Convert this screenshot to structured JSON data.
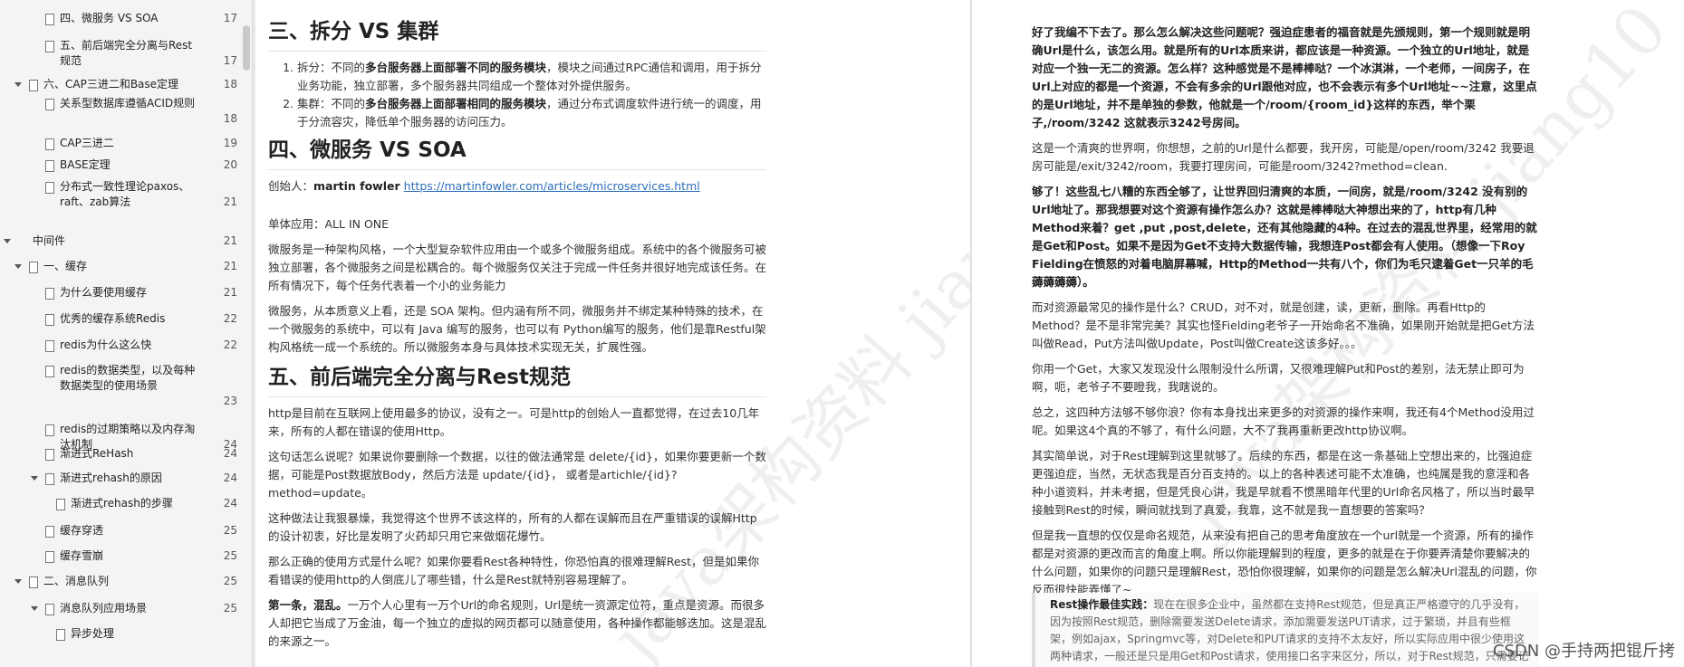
{
  "toc": [
    {
      "text": "四、微服务 VS SOA",
      "page": "17",
      "level": 2,
      "toggle": false
    },
    {
      "text": "五、前后端完全分离与Rest规范",
      "page": "17",
      "level": 2,
      "toggle": false
    },
    {
      "text": "六、CAP三进二和Base定理",
      "page": "18",
      "level": 1,
      "toggle": true
    },
    {
      "text": "关系型数据库遵循ACID规则",
      "page": "18",
      "level": 2,
      "toggle": false
    },
    {
      "text": "CAP三进二",
      "page": "19",
      "level": 2,
      "toggle": false
    },
    {
      "text": "BASE定理",
      "page": "20",
      "level": 2,
      "toggle": false
    },
    {
      "text": "分布式一致性理论paxos、raft、zab算法",
      "page": "21",
      "level": 2,
      "toggle": false
    },
    {
      "text": "中间件",
      "page": "21",
      "level": 0,
      "toggle": true
    },
    {
      "text": "一、缓存",
      "page": "21",
      "level": 1,
      "toggle": true
    },
    {
      "text": "为什么要使用缓存",
      "page": "21",
      "level": 2,
      "toggle": false
    },
    {
      "text": "优秀的缓存系统Redis",
      "page": "22",
      "level": 2,
      "toggle": false
    },
    {
      "text": "redis为什么这么快",
      "page": "22",
      "level": 2,
      "toggle": false
    },
    {
      "text": "redis的数据类型，以及每种数据类型的使用场景",
      "page": "23",
      "level": 2,
      "toggle": false
    },
    {
      "text": "redis的过期策略以及内存淘汰机制",
      "page": "24",
      "level": 2,
      "toggle": false
    },
    {
      "text": "渐进式ReHash",
      "page": "24",
      "level": 2,
      "toggle": false
    },
    {
      "text": "渐进式rehash的原因",
      "page": "24",
      "level": 2,
      "toggle": true
    },
    {
      "text": "渐进式rehash的步骤",
      "page": "24",
      "level": 3,
      "toggle": false
    },
    {
      "text": "缓存穿透",
      "page": "25",
      "level": 2,
      "toggle": false
    },
    {
      "text": "缓存雪崩",
      "page": "25",
      "level": 2,
      "toggle": false
    },
    {
      "text": "二、消息队列",
      "page": "25",
      "level": 1,
      "toggle": true
    },
    {
      "text": "消息队列应用场景",
      "page": "25",
      "level": 2,
      "toggle": true
    },
    {
      "text": "异步处理",
      "page": "",
      "level": 3,
      "toggle": false
    }
  ],
  "watermark": {
    "p1": "java架构资料 jiang10",
    "p2": "java架构资料 jiang10"
  },
  "page1": {
    "h_split": "三、拆分 VS 集群",
    "list": [
      {
        "pre": "拆分：不同的",
        "b": "多台服务器上面部署不同的服务模块",
        "post": "，模块之间通过RPC通信和调用，用于拆分业务功能，独立部署，多个服务器共同组成一个整体对外提供服务。"
      },
      {
        "pre": "集群：不同的",
        "b": "多台服务器上面部署相同的服务模块",
        "post": "，通过分布式调度软件进行统一的调度，用于分流容灾，降低单个服务器的访问压力。"
      }
    ],
    "h_soa": "四、微服务 VS SOA",
    "creator_label": "创始人：",
    "creator_name": "martin fowler",
    "creator_link": "https://martinfowler.com/articles/microservices.html",
    "mono": "单体应用：ALL IN ONE",
    "p_ms1": "微服务是一种架构风格，一个大型复杂软件应用由一个或多个微服务组成。系统中的各个微服务可被独立部署，各个微服务之间是松耦合的。每个微服务仅关注于完成一件任务并很好地完成该任务。在所有情况下，每个任务代表着一个小的业务能力",
    "p_ms2": "微服务，从本质意义上看，还是 SOA 架构。但内涵有所不同，微服务并不绑定某种特殊的技术，在一个微服务的系统中，可以有 Java 编写的服务，也可以有 Python编写的服务，他们是靠Restful架构风格统一成一个系统的。所以微服务本身与具体技术实现无关，扩展性强。",
    "h_rest": "五、前后端完全分离与Rest规范",
    "p_http": "http是目前在互联网上使用最多的协议，没有之一。可是http的创始人一直都觉得，在过去10几年来，所有的人都在错误的使用Http。",
    "p_how": "这句话怎么说呢？如果说你要删除一个数据，以往的做法通常是 delete/{id}，如果你要更新一个数据，可能是Post数据放Body，然后方法是 update/{id}， 或者是artichle/{id}?method=update。",
    "p_kind": "这种做法让我狠暴燥，我觉得这个世界不该这样的，所有的人都在误解而且在严重错误的误解Http的设计初衷，好比是发明了火药却只用它来做烟花爆竹。",
    "p_right": "那么正确的使用方式是什么呢？如果你要看Rest各种特性，你恐怕真的很难理解Rest，但是如果你看错误的使用http的人倒底儿了哪些错，什么是Rest就特别容易理解了。",
    "p_first_b": "第一条，混乱。",
    "p_first": "一万个人心里有一万个Url的命名规则，Url是统一资源定位符，重点是资源。而很多人却把它当成了万金油，每一个独立的虚拟的网页都可以随意使用，各种操作都能够迭加。这是混乱的来源之一。"
  },
  "page2": {
    "p_a": "好了我编不下去了。那么怎么解决这些问题呢？强迫症患者的福音就是先颁规则，第一个规则就是明确Url是什么，该怎么用。就是所有的Url本质来讲，都应该是一种资源。一个独立的Url地址，就是对应一个独一无二的资源。怎么样？这种感觉是不是棒棒哒？一个冰淇淋，一个老师，一间房子，在Url上对应的都是一个资源，不会有多余的Url跟他对应，也不会表示有多个Url地址~~注意，这里点的是Url地址，并不是单独的参数，他就是一个/room/{room_id}这样的东西，举个栗子,/room/3242 这就表示3242号房间。",
    "p_b": "这是一个清爽的世界啊，你想想，之前的Url是什么都要，我开房，可能是/open/room/3242 我要退房可能是/exit/3242/room，我要打理房间，可能是room/3242?method=clean.",
    "p_c": "够了！这些乱七八糟的东西全够了，让世界回归清爽的本质，一间房，就是/room/3242 没有别的Url地址了。那我想要对这个资源有操作怎么办？这就是棒棒哒大神想出来的了，http有几种Method来着？get ,put ,post,delete，还有其他隐藏的4种。在过去的混乱世界里，经常用的就是Get和Post。如果不是因为Get不支持大数据传输，我想连Post都会有人使用。（想像一下Roy Fielding在愤怒的对着电脑屏幕喊，Http的Method一共有八个，你们为毛只逮着Get一只羊的毛薅薅薅薅）。",
    "p_d": "而对资源最常见的操作是什么？CRUD，对不对，就是创建，读，更新，删除。再看Http的Method？是不是非常完美？其实也怪Fielding老爷子一开始命名不准确，如果刚开始就是把Get方法叫做Read，Put方法叫做Update，Post叫做Create这该多好。。。",
    "p_e": "你用一个Get，大家又发现没什么限制没什么所谓，又很难理解Put和Post的差别，法无禁止即可为啊，呃，老爷子不要瞪我，我瞎说的。",
    "p_f": "总之，这四种方法够不够你浪？你有本身找出来更多的对资源的操作来啊，我还有4个Method没用过呢。如果这4个真的不够了，有什么问题，大不了我再重新更改http协议啊。",
    "p_g": "其实简单说，对于Rest理解到这里就够了。后续的东西，都是在这一条基础上空想出来的，比强迫症更强迫症，当然，无状态我是百分百支持的。以上的各种表述可能不太准确，也纯属是我的意淫和各种小道资料，并未考据，但是凭良心讲，我是早就看不惯黑暗年代里的Url命名风格了，所以当时最早接触到Rest的时候，瞬间就找到了真爱，我靠，这不就是我一直想要的答案吗？",
    "p_h": "但是我一直想的仅仅是命名规范，从来没有把自己的思考角度放在一个url就是一个资源，所有的操作都是对资源的更改而言的角度上啊。所以你能理解到的程度，更多的就是在于你要弄清楚你要解决的什么问题，如果你的问题只是理解Rest，恐怕你很理解，如果你的问题是怎么解决Url混乱的问题，你反而很快能弄懂了~",
    "quote_b": "Rest操作最佳实践：",
    "quote": "现在在很多企业中，虽然都在支持Rest规范，但是真正严格遵守的几乎没有，因为按照Rest规范，删除需要发送Delete请求，添加需要发送PUT请求，过于繁琐，并且有些框架，例如ajax，Springmvc等，对Delete和PUT请求的支持不太友好，所以实际应用中很少使用这两种请求，一般还是只是用Get和Post请求，使用接口名字来区分，所以，对于Rest规范，只需要记得传递数据只使用Get和Post即可"
  },
  "csdn": "CSDN @手持两把锟斤拷"
}
